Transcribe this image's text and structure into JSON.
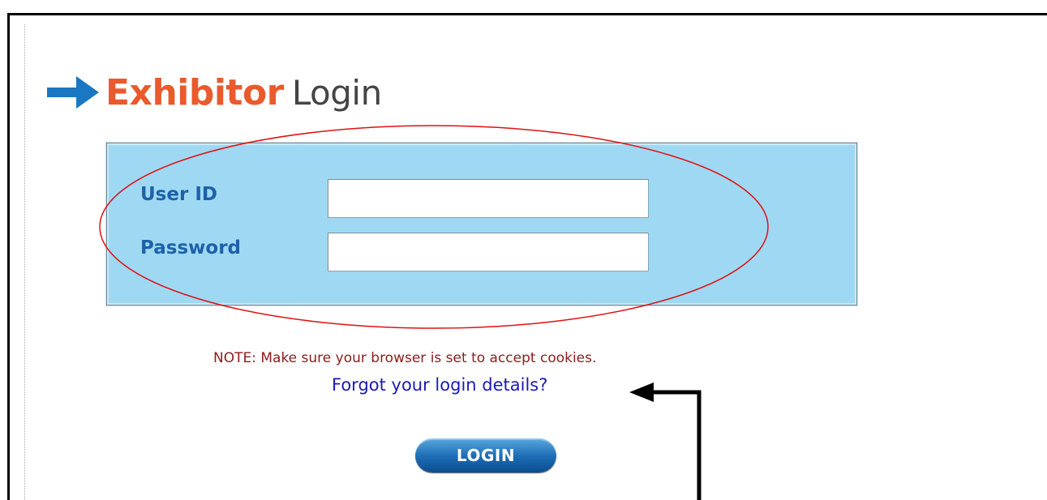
{
  "header": {
    "title_accent": "Exhibitor",
    "title_rest": "Login",
    "icon": "arrow-right-icon"
  },
  "form": {
    "user_id_label": "User ID",
    "password_label": "Password",
    "user_id_value": "",
    "password_value": ""
  },
  "note": "NOTE: Make sure your browser is set to accept cookies.",
  "forgot_link": "Forgot your login details?",
  "login_button": "LOGIN",
  "colors": {
    "accent": "#e95a2c",
    "panel": "#9fd8f3",
    "label": "#1d62a8",
    "link": "#1a1ab5",
    "note": "#8c1c1c",
    "annotation": "#e01010"
  }
}
